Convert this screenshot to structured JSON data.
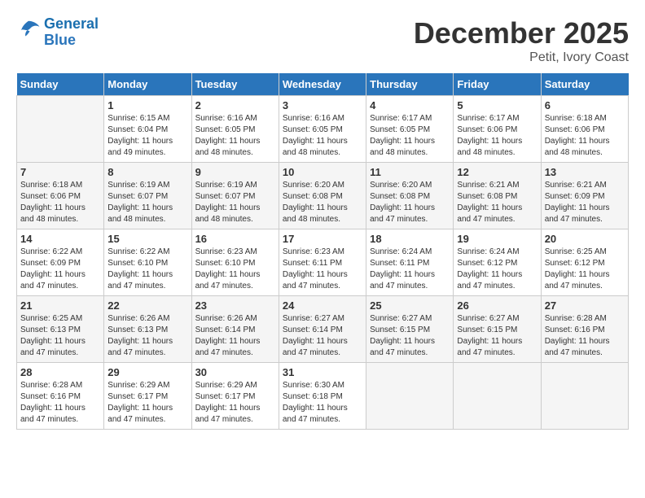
{
  "header": {
    "logo_line1": "General",
    "logo_line2": "Blue",
    "month": "December 2025",
    "location": "Petit, Ivory Coast"
  },
  "days_of_week": [
    "Sunday",
    "Monday",
    "Tuesday",
    "Wednesday",
    "Thursday",
    "Friday",
    "Saturday"
  ],
  "weeks": [
    [
      {
        "day": "",
        "info": ""
      },
      {
        "day": "1",
        "info": "Sunrise: 6:15 AM\nSunset: 6:04 PM\nDaylight: 11 hours\nand 49 minutes."
      },
      {
        "day": "2",
        "info": "Sunrise: 6:16 AM\nSunset: 6:05 PM\nDaylight: 11 hours\nand 48 minutes."
      },
      {
        "day": "3",
        "info": "Sunrise: 6:16 AM\nSunset: 6:05 PM\nDaylight: 11 hours\nand 48 minutes."
      },
      {
        "day": "4",
        "info": "Sunrise: 6:17 AM\nSunset: 6:05 PM\nDaylight: 11 hours\nand 48 minutes."
      },
      {
        "day": "5",
        "info": "Sunrise: 6:17 AM\nSunset: 6:06 PM\nDaylight: 11 hours\nand 48 minutes."
      },
      {
        "day": "6",
        "info": "Sunrise: 6:18 AM\nSunset: 6:06 PM\nDaylight: 11 hours\nand 48 minutes."
      }
    ],
    [
      {
        "day": "7",
        "info": "Sunrise: 6:18 AM\nSunset: 6:06 PM\nDaylight: 11 hours\nand 48 minutes."
      },
      {
        "day": "8",
        "info": "Sunrise: 6:19 AM\nSunset: 6:07 PM\nDaylight: 11 hours\nand 48 minutes."
      },
      {
        "day": "9",
        "info": "Sunrise: 6:19 AM\nSunset: 6:07 PM\nDaylight: 11 hours\nand 48 minutes."
      },
      {
        "day": "10",
        "info": "Sunrise: 6:20 AM\nSunset: 6:08 PM\nDaylight: 11 hours\nand 48 minutes."
      },
      {
        "day": "11",
        "info": "Sunrise: 6:20 AM\nSunset: 6:08 PM\nDaylight: 11 hours\nand 47 minutes."
      },
      {
        "day": "12",
        "info": "Sunrise: 6:21 AM\nSunset: 6:08 PM\nDaylight: 11 hours\nand 47 minutes."
      },
      {
        "day": "13",
        "info": "Sunrise: 6:21 AM\nSunset: 6:09 PM\nDaylight: 11 hours\nand 47 minutes."
      }
    ],
    [
      {
        "day": "14",
        "info": "Sunrise: 6:22 AM\nSunset: 6:09 PM\nDaylight: 11 hours\nand 47 minutes."
      },
      {
        "day": "15",
        "info": "Sunrise: 6:22 AM\nSunset: 6:10 PM\nDaylight: 11 hours\nand 47 minutes."
      },
      {
        "day": "16",
        "info": "Sunrise: 6:23 AM\nSunset: 6:10 PM\nDaylight: 11 hours\nand 47 minutes."
      },
      {
        "day": "17",
        "info": "Sunrise: 6:23 AM\nSunset: 6:11 PM\nDaylight: 11 hours\nand 47 minutes."
      },
      {
        "day": "18",
        "info": "Sunrise: 6:24 AM\nSunset: 6:11 PM\nDaylight: 11 hours\nand 47 minutes."
      },
      {
        "day": "19",
        "info": "Sunrise: 6:24 AM\nSunset: 6:12 PM\nDaylight: 11 hours\nand 47 minutes."
      },
      {
        "day": "20",
        "info": "Sunrise: 6:25 AM\nSunset: 6:12 PM\nDaylight: 11 hours\nand 47 minutes."
      }
    ],
    [
      {
        "day": "21",
        "info": "Sunrise: 6:25 AM\nSunset: 6:13 PM\nDaylight: 11 hours\nand 47 minutes."
      },
      {
        "day": "22",
        "info": "Sunrise: 6:26 AM\nSunset: 6:13 PM\nDaylight: 11 hours\nand 47 minutes."
      },
      {
        "day": "23",
        "info": "Sunrise: 6:26 AM\nSunset: 6:14 PM\nDaylight: 11 hours\nand 47 minutes."
      },
      {
        "day": "24",
        "info": "Sunrise: 6:27 AM\nSunset: 6:14 PM\nDaylight: 11 hours\nand 47 minutes."
      },
      {
        "day": "25",
        "info": "Sunrise: 6:27 AM\nSunset: 6:15 PM\nDaylight: 11 hours\nand 47 minutes."
      },
      {
        "day": "26",
        "info": "Sunrise: 6:27 AM\nSunset: 6:15 PM\nDaylight: 11 hours\nand 47 minutes."
      },
      {
        "day": "27",
        "info": "Sunrise: 6:28 AM\nSunset: 6:16 PM\nDaylight: 11 hours\nand 47 minutes."
      }
    ],
    [
      {
        "day": "28",
        "info": "Sunrise: 6:28 AM\nSunset: 6:16 PM\nDaylight: 11 hours\nand 47 minutes."
      },
      {
        "day": "29",
        "info": "Sunrise: 6:29 AM\nSunset: 6:17 PM\nDaylight: 11 hours\nand 47 minutes."
      },
      {
        "day": "30",
        "info": "Sunrise: 6:29 AM\nSunset: 6:17 PM\nDaylight: 11 hours\nand 47 minutes."
      },
      {
        "day": "31",
        "info": "Sunrise: 6:30 AM\nSunset: 6:18 PM\nDaylight: 11 hours\nand 47 minutes."
      },
      {
        "day": "",
        "info": ""
      },
      {
        "day": "",
        "info": ""
      },
      {
        "day": "",
        "info": ""
      }
    ]
  ]
}
